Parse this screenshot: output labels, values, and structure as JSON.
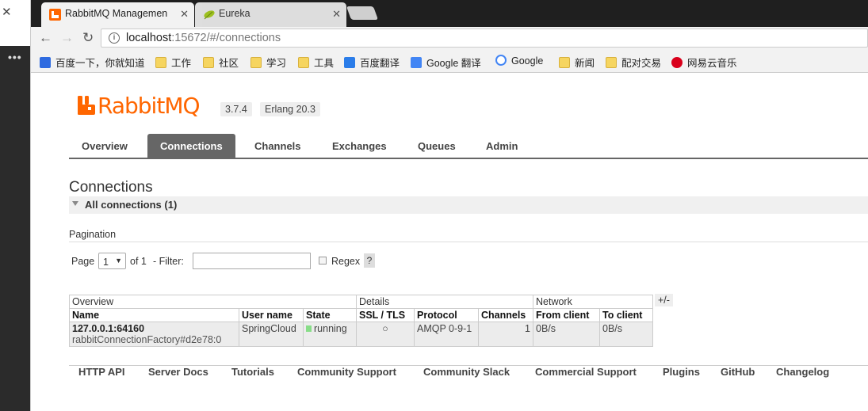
{
  "browser": {
    "tabs": [
      {
        "title": "RabbitMQ Managemen",
        "close": "✕"
      },
      {
        "title": "Eureka",
        "close": "✕"
      }
    ],
    "url_host": "localhost",
    "url_rest": ":15672/#/connections",
    "bookmarks": [
      "百度一下，你就知道",
      "工作",
      "社区",
      "学习",
      "工具",
      "百度翻译",
      "Google 翻译",
      "Google",
      "新闻",
      "配对交易",
      "网易云音乐"
    ]
  },
  "left_strip": {
    "close": "✕",
    "more": "•••"
  },
  "app": {
    "logo_rabbit": "Rabbit",
    "logo_mq": "MQ",
    "version": "3.7.4",
    "erlang": "Erlang 20.3",
    "nav": [
      "Overview",
      "Connections",
      "Channels",
      "Exchanges",
      "Queues",
      "Admin"
    ],
    "active_nav": "Connections",
    "page_title": "Connections",
    "section_title": "All connections (1)",
    "pagination": {
      "heading": "Pagination",
      "page_label": "Page",
      "page_value": "1",
      "of_label": "of 1",
      "filter_label": "- Filter:",
      "regex_label": "Regex",
      "help": "?"
    },
    "table": {
      "groups": [
        "Overview",
        "Details",
        "Network"
      ],
      "headers": [
        "Name",
        "User name",
        "State",
        "SSL / TLS",
        "Protocol",
        "Channels",
        "From client",
        "To client"
      ],
      "rows": [
        {
          "name": "127.0.0.1:64160",
          "name_sub": "rabbitConnectionFactory#d2e78:0",
          "user": "SpringCloud",
          "state": "running",
          "ssl": "○",
          "protocol": "AMQP 0-9-1",
          "channels": "1",
          "from_client": "0B/s",
          "to_client": "0B/s"
        }
      ],
      "plus_minus": "+/-"
    },
    "footer": [
      "HTTP API",
      "Server Docs",
      "Tutorials",
      "Community Support",
      "Community Slack",
      "Commercial Support",
      "Plugins",
      "GitHub",
      "Changelog"
    ]
  }
}
